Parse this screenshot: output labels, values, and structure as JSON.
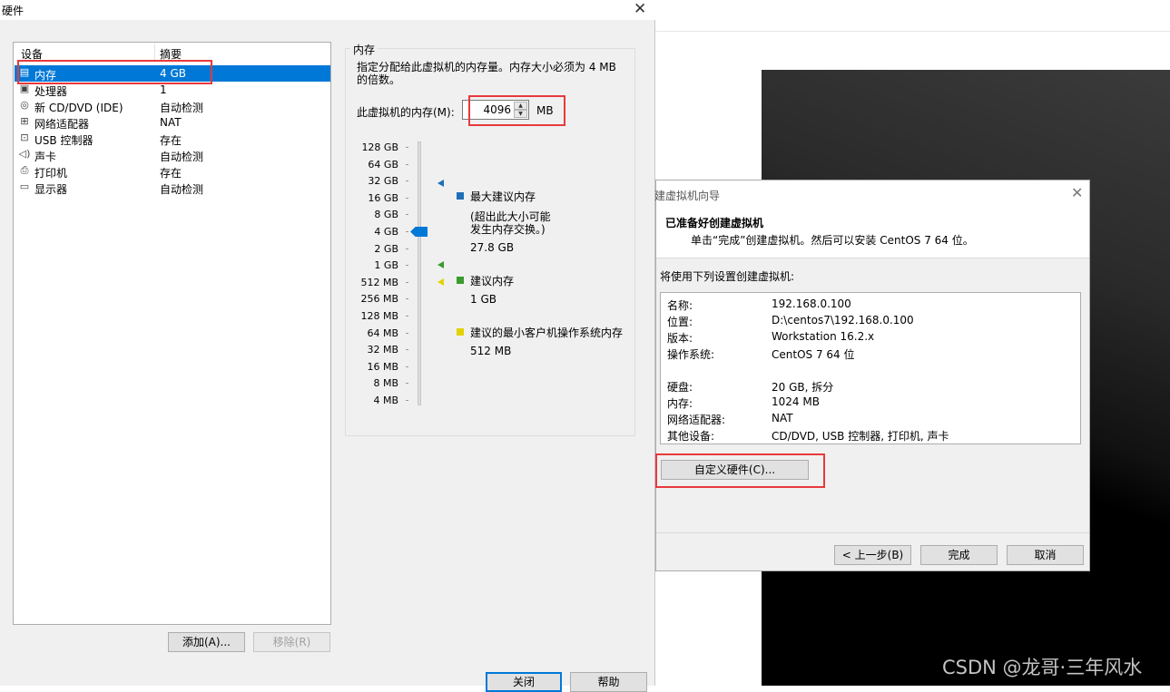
{
  "hardware_dialog": {
    "title": "硬件",
    "close_glyph": "✕",
    "columns": {
      "device": "设备",
      "summary": "摘要"
    },
    "devices": [
      {
        "icon": "memory-icon",
        "glyph": "▤",
        "name": "内存",
        "summary": "4 GB",
        "selected": true
      },
      {
        "icon": "processor-icon",
        "glyph": "▣",
        "name": "处理器",
        "summary": "1"
      },
      {
        "icon": "cd-dvd-icon",
        "glyph": "◎",
        "name": "新 CD/DVD (IDE)",
        "summary": "自动检测"
      },
      {
        "icon": "network-adapter-icon",
        "glyph": "⊞",
        "name": "网络适配器",
        "summary": "NAT"
      },
      {
        "icon": "usb-icon",
        "glyph": "⊡",
        "name": "USB 控制器",
        "summary": "存在"
      },
      {
        "icon": "sound-card-icon",
        "glyph": "◁)",
        "name": "声卡",
        "summary": "自动检测"
      },
      {
        "icon": "printer-icon",
        "glyph": "⎙",
        "name": "打印机",
        "summary": "存在"
      },
      {
        "icon": "display-icon",
        "glyph": "▭",
        "name": "显示器",
        "summary": "自动检测"
      }
    ],
    "add_button": "添加(A)...",
    "remove_button": "移除(R)",
    "close_button": "关闭",
    "help_button": "帮助",
    "memory": {
      "group_label": "内存",
      "description": "指定分配给此虚拟机的内存量。内存大小必须为 4 MB 的倍数。",
      "field_label": "此虚拟机的内存(M):",
      "value": "4096",
      "unit": "MB",
      "spin_up": "▲",
      "spin_down": "▼",
      "scale_ticks": [
        "128 GB",
        "64 GB",
        "32 GB",
        "16 GB",
        "8 GB",
        "4 GB",
        "2 GB",
        "1 GB",
        "512 MB",
        "256 MB",
        "128 MB",
        "64 MB",
        "32 MB",
        "16 MB",
        "8 MB",
        "4 MB"
      ],
      "slider_position_tick": "4 GB",
      "legend": {
        "max": {
          "title": "最大建议内存",
          "note_line1": "(超出此大小可能",
          "note_line2": "发生内存交换。)",
          "value": "27.8 GB",
          "color": "#1e6fb8"
        },
        "recommended": {
          "title": "建议内存",
          "value": "1 GB",
          "color": "#3a9b2f"
        },
        "guest_min": {
          "title": "建议的最小客户机操作系统内存",
          "value": "512 MB",
          "color": "#e2d300"
        }
      }
    }
  },
  "wizard": {
    "title": "建虚拟机向导",
    "close_glyph": "✕",
    "heading": "已准备好创建虚拟机",
    "subheading": "单击“完成”创建虚拟机。然后可以安装 CentOS 7 64 位。",
    "intro": "将使用下列设置创建虚拟机:",
    "summary": [
      {
        "label": "名称:",
        "value": "192.168.0.100"
      },
      {
        "label": "位置:",
        "value": "D:\\centos7\\192.168.0.100"
      },
      {
        "label": "版本:",
        "value": "Workstation 16.2.x"
      },
      {
        "label": "操作系统:",
        "value": "CentOS 7 64 位"
      },
      {
        "label": "硬盘:",
        "value": "20 GB, 拆分"
      },
      {
        "label": "内存:",
        "value": "1024 MB"
      },
      {
        "label": "网络适配器:",
        "value": "NAT"
      },
      {
        "label": "其他设备:",
        "value": "CD/DVD, USB 控制器, 打印机, 声卡"
      }
    ],
    "customize_button": "自定义硬件(C)...",
    "back_button": "< 上一步(B)",
    "finish_button": "完成",
    "cancel_button": "取消"
  },
  "watermark": "CSDN @龙哥·三年风水",
  "colors": {
    "selection": "#0078d7",
    "annotation_red": "#e8393c"
  }
}
